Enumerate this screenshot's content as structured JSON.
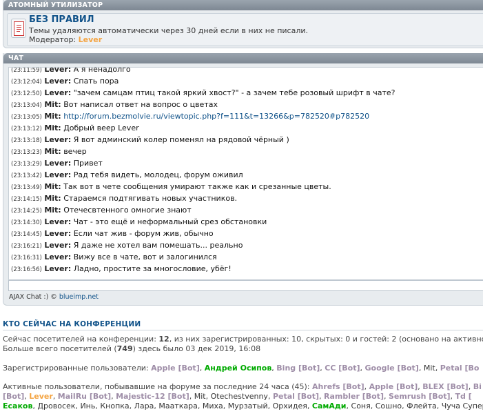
{
  "forum_category": {
    "title": "АТОМНЫЙ УТИЛИЗАТОР",
    "forum_name": "БЕЗ ПРАВИЛ",
    "description": "Темы удаляются автоматически через 30 дней если в них не писали.",
    "moderator_label": "Модератор:",
    "moderator_name": "Lever"
  },
  "chat": {
    "title": "ЧАТ",
    "messages": [
      {
        "time": "(23:11:59)",
        "user": "Lever:",
        "text": "А я ненадолго"
      },
      {
        "time": "(23:12:04)",
        "user": "Lever:",
        "text": "Спать пора"
      },
      {
        "time": "(23:12:50)",
        "user": "Lever:",
        "text": "\"зачем самцам птиц такой яркий хвост?\" - а зачем тебе розовый шрифт в чате?"
      },
      {
        "time": "(23:13:04)",
        "user": "Mit:",
        "text": "Вот написал ответ на вопрос о цветах"
      },
      {
        "time": "(23:13:05)",
        "user": "Mit:",
        "text": "http://forum.bezmolvie.ru/viewtopic.php?f=111&t=13266&p=782520#p782520"
      },
      {
        "time": "(23:13:12)",
        "user": "Mit:",
        "text": "Добрый веер Lever"
      },
      {
        "time": "(23:13:18)",
        "user": "Lever:",
        "text": "Я вот админский колер поменял на рядовой чёрный )"
      },
      {
        "time": "(23:13:23)",
        "user": "Mit:",
        "text": "вечер"
      },
      {
        "time": "(23:13:29)",
        "user": "Lever:",
        "text": "Привет"
      },
      {
        "time": "(23:13:42)",
        "user": "Lever:",
        "text": "Рад тебя видеть, молодец, форум оживил"
      },
      {
        "time": "(23:13:49)",
        "user": "Mit:",
        "text": "Так вот в чете сообщения умирают также как и срезанные цветы."
      },
      {
        "time": "(23:14:15)",
        "user": "Mit:",
        "text": "Стараемся подтягивать новых участников."
      },
      {
        "time": "(23:14:25)",
        "user": "Mit:",
        "text": "Отечесвтенного омногие знают"
      },
      {
        "time": "(23:14:30)",
        "user": "Lever:",
        "text": "Чат - это ещё и неформальный срез обстановки"
      },
      {
        "time": "(23:14:45)",
        "user": "Lever:",
        "text": "Если чат жив - форум жив, обычно"
      },
      {
        "time": "(23:16:21)",
        "user": "Lever:",
        "text": "Я даже не хотел вам помешать... реально"
      },
      {
        "time": "(23:16:31)",
        "user": "Lever:",
        "text": "Вижу все в чате, вот и залогинился"
      },
      {
        "time": "(23:16:56)",
        "user": "Lever:",
        "text": "Ладно, простите за многословие, убёг!"
      }
    ],
    "credit_prefix": "AJAX Chat :) ©",
    "credit_link": "blueimp.net"
  },
  "whos_online": {
    "title": "КТО СЕЙЧАС НА КОНФЕРЕНЦИИ",
    "line1_prefix": "Сейчас посетителей на конференции:",
    "line1_total": "12",
    "line1_rest": ", из них зарегистрированных: 10, скрытых: 0 и гостей: 2 (основано на активно",
    "line2_prefix": "Больше всего посетителей (",
    "line2_max": "749",
    "line2_rest": ") здесь было 03 дек 2019, 16:08",
    "registered_label": "Зарегистрированные пользователи:",
    "registered_users": [
      {
        "name": "Apple [Bot]",
        "style": "bot"
      },
      {
        "name": "Андрей Осипов",
        "style": "green"
      },
      {
        "name": "Bing [Bot]",
        "style": "bot"
      },
      {
        "name": "CC [Bot]",
        "style": "bot"
      },
      {
        "name": "Google [Bot]",
        "style": "bot"
      },
      {
        "name": "Mit",
        "style": "dark"
      },
      {
        "name": "Petal [Bo",
        "style": "bot"
      }
    ],
    "active_label": "Активные пользователи, побывавшие на форуме за последние 24 часа (45):",
    "active_line1": [
      {
        "name": "Ahrefs [Bot]",
        "style": "bot"
      },
      {
        "name": "Apple [Bot]",
        "style": "bot"
      },
      {
        "name": "BLEX [Bot]",
        "style": "bot"
      },
      {
        "name": "Bi",
        "style": "bot"
      }
    ],
    "active_line2": [
      {
        "name": "[Bot]",
        "style": "bot"
      },
      {
        "name": "Lever",
        "style": "orange"
      },
      {
        "name": "MailRu [Bot]",
        "style": "bot"
      },
      {
        "name": "Majestic-12 [Bot]",
        "style": "bot"
      },
      {
        "name": "Mit",
        "style": "dark"
      },
      {
        "name": "Otechestvenny",
        "style": "dark"
      },
      {
        "name": "Petal [Bot]",
        "style": "bot"
      },
      {
        "name": "Rambler [Bot]",
        "style": "bot"
      },
      {
        "name": "Semrush [Bot]",
        "style": "bot"
      },
      {
        "name": "Td [",
        "style": "bot"
      }
    ],
    "active_line3": [
      {
        "name": "Есаков",
        "style": "green"
      },
      {
        "name": "Дровосек",
        "style": "dark"
      },
      {
        "name": "Инь",
        "style": "dark"
      },
      {
        "name": "Кнопка",
        "style": "dark"
      },
      {
        "name": "Лара",
        "style": "dark"
      },
      {
        "name": "Мааткара",
        "style": "dark"
      },
      {
        "name": "Миха",
        "style": "dark"
      },
      {
        "name": "Мурзатый",
        "style": "dark"
      },
      {
        "name": "Орхидея",
        "style": "dark"
      },
      {
        "name": "СамАди",
        "style": "green"
      },
      {
        "name": "Соня",
        "style": "dark"
      },
      {
        "name": "Сошно",
        "style": "dark"
      },
      {
        "name": "Флейта",
        "style": "dark"
      },
      {
        "name": "Чуча Супер",
        "style": "dark"
      }
    ]
  }
}
